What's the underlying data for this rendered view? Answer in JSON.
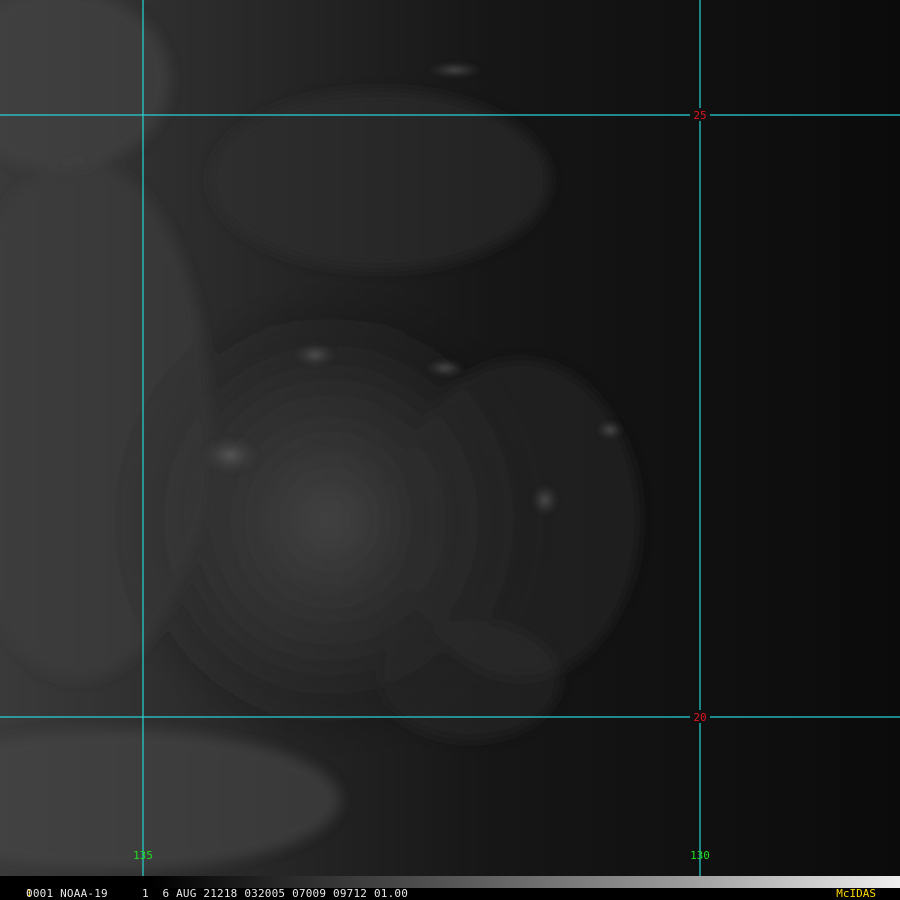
{
  "image": {
    "kind": "satellite visible imagery",
    "colors": {
      "grid_line": "#28d2d2",
      "lat_label": "#e0141e",
      "lon_label": "#22dd22",
      "caption": "#e8e8e8",
      "brand": "#ffd800"
    }
  },
  "graticule": {
    "latitudes": [
      {
        "label": "25"
      },
      {
        "label": "20"
      }
    ],
    "longitudes": [
      {
        "label": "135"
      },
      {
        "label": "130"
      }
    ]
  },
  "footer": {
    "frame_number": "1",
    "caption": "0001 NOAA-19     1  6 AUG 21218 032005 07009 09712 01.00",
    "brand": "McIDAS"
  }
}
